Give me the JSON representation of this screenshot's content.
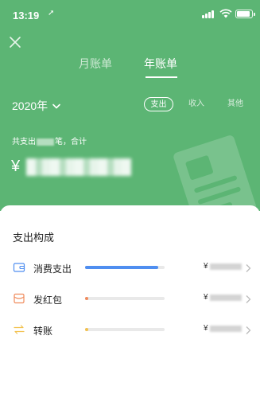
{
  "status_bar": {
    "time": "13:19",
    "location_arrow": "➚"
  },
  "header": {
    "tabs": [
      {
        "label": "月账单",
        "active": false
      },
      {
        "label": "年账单",
        "active": true
      }
    ]
  },
  "year_picker": {
    "label": "2020年"
  },
  "filters": {
    "expense": "支出",
    "income": "收入",
    "other": "其他"
  },
  "summary": {
    "prefix": "共支出",
    "suffix": "笔，合计"
  },
  "total": {
    "currency": "¥"
  },
  "composition": {
    "title": "支出构成",
    "items": [
      {
        "name": "消费支出",
        "currency": "¥",
        "share": 0.92,
        "color": "#4f8ef0",
        "icon": "wallet-icon"
      },
      {
        "name": "发红包",
        "currency": "¥",
        "share": 0.03,
        "color": "#f08b5c",
        "icon": "red-packet-icon"
      },
      {
        "name": "转账",
        "currency": "¥",
        "share": 0.03,
        "color": "#f2c14e",
        "icon": "transfer-icon"
      }
    ]
  },
  "colors": {
    "header_bg": "#5cb574",
    "bar_track": "#e9e9e9"
  }
}
